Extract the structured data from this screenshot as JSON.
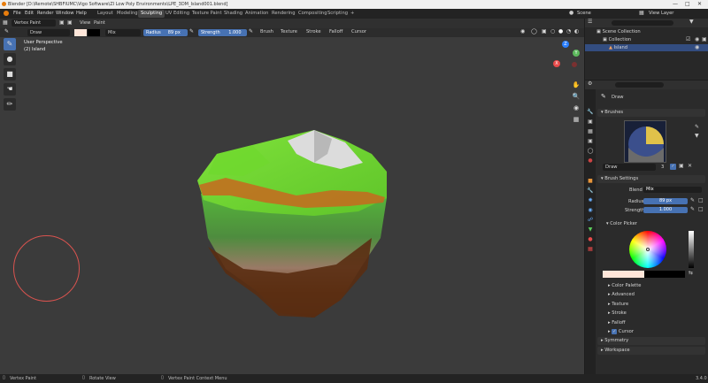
{
  "titlebar": {
    "title": "Blender [D:\\Remote\\SHBFIUMC\\Vigo Software\\ZI Low Poly Environments\\LPE_3DM_Island001.blend]"
  },
  "menubar": {
    "menus": [
      "File",
      "Edit",
      "Render",
      "Window",
      "Help"
    ],
    "workspaces": [
      "Layout",
      "Modeling",
      "Sculpting",
      "UV Editing",
      "Texture Paint",
      "Shading",
      "Animation",
      "Rendering",
      "Compositing",
      "Scripting"
    ],
    "active_workspace": "Sculpting",
    "add_tab": "+",
    "scene_label": "Scene",
    "view_layer_label": "View Layer"
  },
  "viewport_header": {
    "mode": "Vertex Paint",
    "view": "View",
    "paint": "Paint",
    "brush_name": "Draw",
    "blend": "Mix",
    "radius_label": "Radius",
    "radius_value": "89 px",
    "strength_label": "Strength",
    "strength_value": "1.000",
    "menus": [
      "Brush",
      "Texture",
      "Stroke",
      "Falloff",
      "Cursor"
    ]
  },
  "overlay": {
    "view_name": "User Perspective",
    "object_name": "(2) Island"
  },
  "navigation_gizmo": {
    "axes": [
      "X",
      "Y",
      "Z"
    ]
  },
  "statusbar": {
    "left": "Vertex Paint",
    "middle": "Rotate View",
    "right": "Vertex Paint Context Menu",
    "version": "3.4.0"
  },
  "outliner": {
    "items": [
      "Scene Collection",
      "Collection",
      "Island"
    ]
  },
  "properties": {
    "active_tool": "Draw",
    "brushes_title": "Brushes",
    "brush_name": "Draw",
    "brush_users": "3",
    "brush_settings_title": "Brush Settings",
    "blend_label": "Blend",
    "blend_value": "Mix",
    "radius_label": "Radius",
    "radius_value": "89 px",
    "strength_label": "Strength",
    "strength_value": "1.000",
    "color_picker_title": "Color Picker",
    "subpanels": [
      "Color Palette",
      "Advanced",
      "Texture",
      "Stroke",
      "Falloff"
    ],
    "cursor_label": "Cursor",
    "collapsed_panels": [
      "Symmetry",
      "Workspace"
    ]
  },
  "colors": {
    "accent": "#4772b3",
    "brush_color": "#ffe6d9",
    "secondary_color": "#000000",
    "cursor_ring": "#d9534f"
  }
}
